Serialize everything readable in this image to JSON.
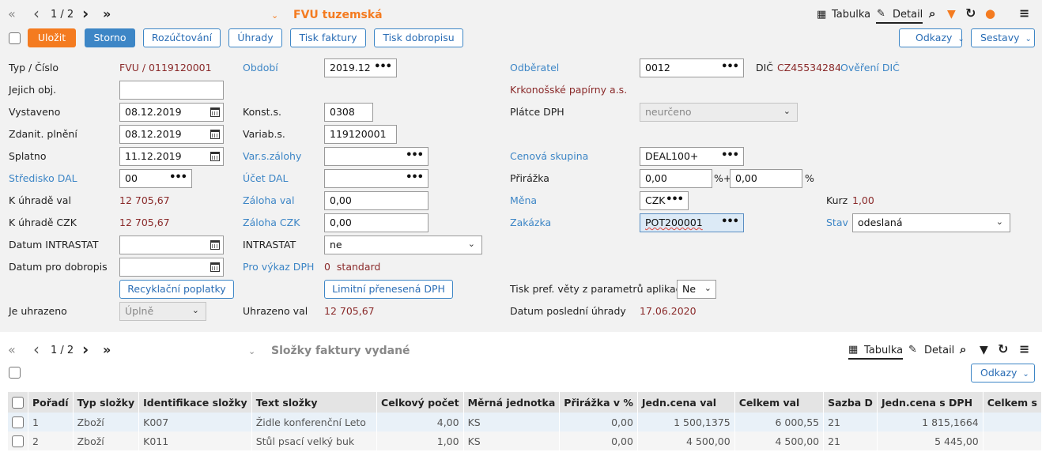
{
  "header": {
    "nav_first": "«",
    "nav_prev": "‹",
    "pager": "1 / 2",
    "nav_next": "›",
    "nav_last": "»",
    "title": "FVU tuzemská",
    "view_table": "Tabulka",
    "view_detail": "Detail"
  },
  "toolbar": {
    "save": "Uložit",
    "cancel": "Storno",
    "allocation": "Rozúčtování",
    "payments": "Úhrady",
    "print_invoice": "Tisk faktury",
    "print_credit": "Tisk dobropisu",
    "links": "Odkazy",
    "reports": "Sestavy"
  },
  "form": {
    "typ_cislo_label": "Typ / Číslo",
    "typ_cislo_value": "FVU / 0119120001",
    "jejich_obj_label": "Jejich obj.",
    "jejich_obj_value": "",
    "vystaveno_label": "Vystaveno",
    "vystaveno_value": "08.12.2019",
    "zdanit_label": "Zdanit. plnění",
    "zdanit_value": "08.12.2019",
    "splatno_label": "Splatno",
    "splatno_value": "11.12.2019",
    "stredisko_label": "Středisko DAL",
    "stredisko_value": "00",
    "k_uhrade_val_label": "K úhradě val",
    "k_uhrade_val_value": "12 705,67",
    "k_uhrade_czk_label": "K úhradě CZK",
    "k_uhrade_czk_value": "12 705,67",
    "datum_intrastat_label": "Datum INTRASTAT",
    "datum_dobropis_label": "Datum pro dobropis",
    "recyklacni_button": "Recyklační poplatky",
    "je_uhrazeno_label": "Je uhrazeno",
    "je_uhrazeno_value": "Úplně",
    "obdobi_label": "Období",
    "obdobi_value": "2019.12",
    "konst_label": "Konst.s.",
    "konst_value": "0308",
    "variab_label": "Variab.s.",
    "variab_value": "119120001",
    "var_zalohy_label": "Var.s.zálohy",
    "ucet_dal_label": "Účet DAL",
    "zaloha_val_label": "Záloha val",
    "zaloha_val_value": "0,00",
    "zaloha_czk_label": "Záloha CZK",
    "zaloha_czk_value": "0,00",
    "intrastat_label": "INTRASTAT",
    "intrastat_value": "ne",
    "pro_vykaz_label": "Pro výkaz DPH",
    "pro_vykaz_value": "0  standard",
    "limitni_button": "Limitní přenesená DPH",
    "uhrazeno_val_label": "Uhrazeno val",
    "uhrazeno_val_value": "12 705,67",
    "odberatel_label": "Odběratel",
    "odberatel_value": "0012",
    "dic_label": "DIČ",
    "dic_value": "CZ45534284",
    "overeni_dic": "Ověření DIČ",
    "odberatel_name": "Krkonošské papírny a.s.",
    "platce_label": "Plátce DPH",
    "platce_value": "neurčeno",
    "cenova_label": "Cenová skupina",
    "cenova_value": "DEAL100+",
    "prirazka_label": "Přirážka",
    "prirazka_value1": "0,00",
    "prirazka_sep": "%+",
    "prirazka_value2": "0,00",
    "prirazka_pct": "%",
    "mena_label": "Měna",
    "mena_value": "CZK",
    "kurz_label": "Kurz",
    "kurz_value": "1,00",
    "zakazka_label": "Zakázka",
    "zakazka_value": "POT200001",
    "stav_label": "Stav",
    "stav_value": "odeslaná",
    "tisk_pref_label": "Tisk pref. věty z parametrů aplikace",
    "tisk_pref_value": "Ne",
    "datum_posledni_label": "Datum poslední úhrady",
    "datum_posledni_value": "17.06.2020"
  },
  "lower": {
    "pager": "1 / 2",
    "title": "Složky faktury vydané",
    "view_table": "Tabulka",
    "view_detail": "Detail",
    "links": "Odkazy",
    "columns": [
      "Pořadí",
      "Typ složky",
      "Identifikace složky",
      "Text složky",
      "Celkový počet",
      "Měrná jednotka",
      "Přirážka v %",
      "Jedn.cena val",
      "Celkem val",
      "Sazba D",
      "Jedn.cena s DPH",
      "Celkem s"
    ],
    "rows": [
      [
        "1",
        "Zboží",
        "K007",
        "Židle konferenční Leto",
        "4,00",
        "KS",
        "0,00",
        "1 500,1375",
        "6 000,55",
        "21",
        "1 815,1664",
        ""
      ],
      [
        "2",
        "Zboží",
        "K011",
        "Stůl psací velký buk",
        "1,00",
        "KS",
        "0,00",
        "4 500,00",
        "4 500,00",
        "21",
        "5 445,00",
        ""
      ]
    ]
  }
}
